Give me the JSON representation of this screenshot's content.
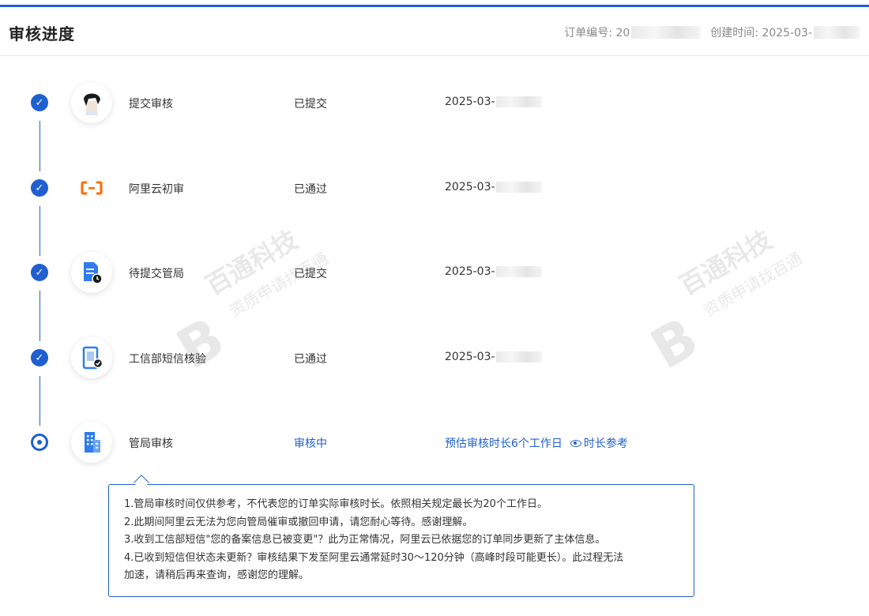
{
  "header": {
    "title": "审核进度",
    "order_no_label": "订单编号: 20",
    "created_label": "创建时间: 2025-03-"
  },
  "steps": [
    {
      "name": "提交审核",
      "status": "已提交",
      "time": "2025-03-",
      "icon": "avatar-icon"
    },
    {
      "name": "阿里云初审",
      "status": "已通过",
      "time": "2025-03-",
      "icon": "aliyun-logo-icon"
    },
    {
      "name": "待提交管局",
      "status": "已提交",
      "time": "2025-03-",
      "icon": "document-clock-icon"
    },
    {
      "name": "工信部短信核验",
      "status": "已通过",
      "time": "2025-03-",
      "icon": "phone-check-icon"
    },
    {
      "name": "管局审核",
      "status": "审核中",
      "estimate": "预估审核时长6个工作日",
      "ref_link": "时长参考",
      "icon": "building-icon"
    }
  ],
  "tooltip": {
    "lines": [
      "1.管局审核时间仅供参考，不代表您的订单实际审核时长。依照相关规定最长为20个工作日。",
      "2.此期间阿里云无法为您向管局催审或撤回申请，请您耐心等待。感谢理解。",
      "3.收到工信部短信\"您的备案信息已被变更\"？此为正常情况，阿里云已依据您的订单同步更新了主体信息。",
      "4.已收到短信但状态未更新？审核结果下发至阿里云通常延时30～120分钟（高峰时段可能更长）。此过程无法",
      "加速，请稍后再来查询，感谢您的理解。"
    ]
  },
  "watermark": {
    "name": "百通科技",
    "slogan": "资质申请找百通"
  },
  "colors": {
    "accent": "#1f5fd1",
    "aliyun_orange": "#ff6a00"
  }
}
